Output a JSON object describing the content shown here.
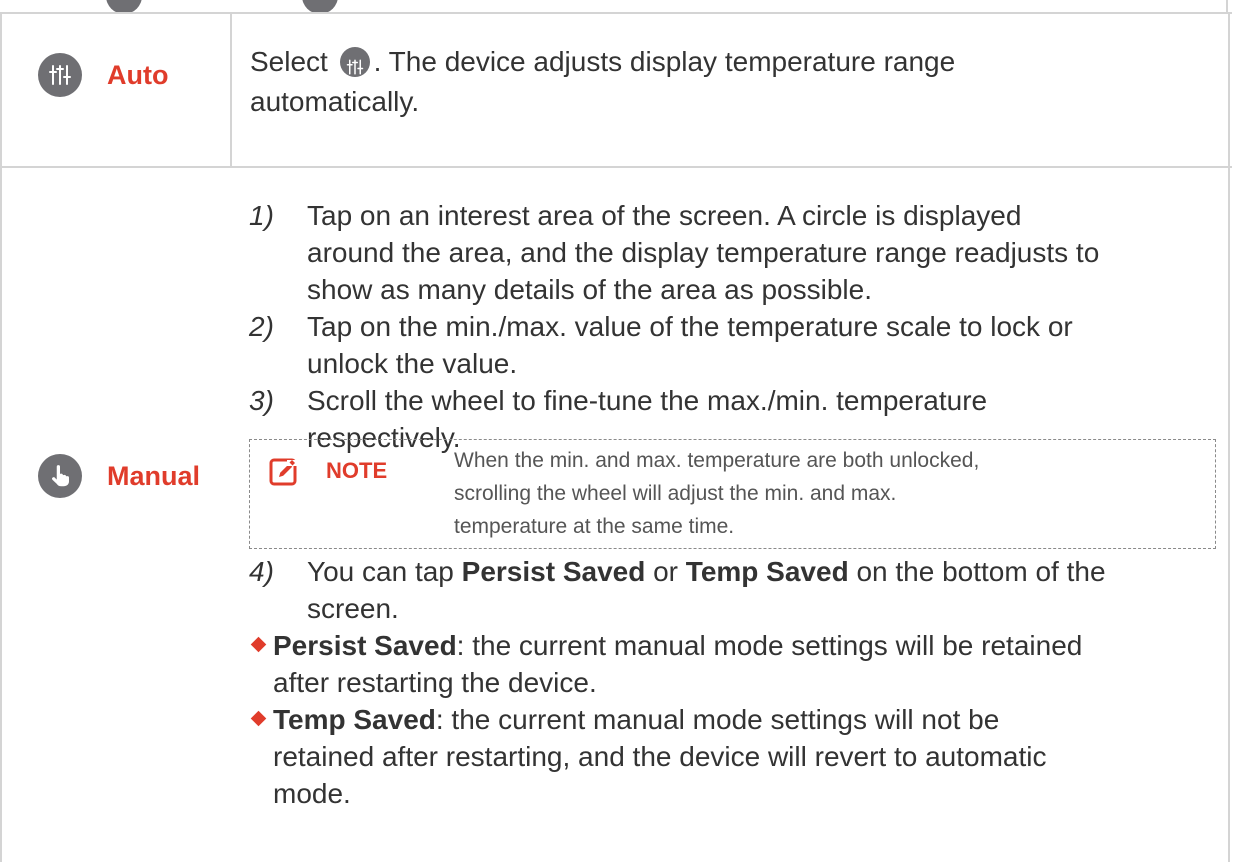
{
  "auto": {
    "label": "Auto",
    "text_before_icon": "Select",
    "text_after_icon_line1": ". The device adjusts display temperature range",
    "text_line2": "automatically."
  },
  "manual": {
    "label": "Manual",
    "steps": [
      {
        "num": "1)",
        "lines": [
          "Tap on an interest area of the screen. A circle is displayed",
          "around the area, and the display temperature range readjusts to",
          "show as many details of the area as possible."
        ]
      },
      {
        "num": "2)",
        "lines": [
          "Tap on the min./max. value of the temperature scale to lock or",
          "unlock the value."
        ]
      },
      {
        "num": "3)",
        "lines": [
          "Scroll the wheel to fine-tune the max./min. temperature",
          "respectively."
        ]
      }
    ],
    "note": {
      "label": "NOTE",
      "lines": [
        "When the min. and max. temperature are both unlocked,",
        "scrolling the wheel will adjust the min. and max.",
        "temperature at the same time."
      ]
    },
    "step4": {
      "num": "4)",
      "pre": "You can tap ",
      "bold1": "Persist Saved",
      "mid": " or ",
      "bold2": "Temp Saved",
      "post": " on the bottom of the",
      "line2": "screen."
    },
    "bullets": [
      {
        "term": "Persist Saved",
        "line1": ": the current manual mode settings will be retained",
        "line2": "after restarting the device.",
        "line3": ""
      },
      {
        "term": "Temp Saved",
        "line1": ": the current manual mode settings will not be",
        "line2": "retained after restarting, and the device will revert to automatic",
        "line3": "mode."
      }
    ]
  },
  "icons": {
    "auto": "sliders-icon",
    "manual": "hand-pointer-icon",
    "note": "edit-note-icon"
  },
  "colors": {
    "accent": "#e03c2b",
    "icon_bg": "#6f6f73",
    "border": "#d4d4d4",
    "text": "#333333"
  }
}
